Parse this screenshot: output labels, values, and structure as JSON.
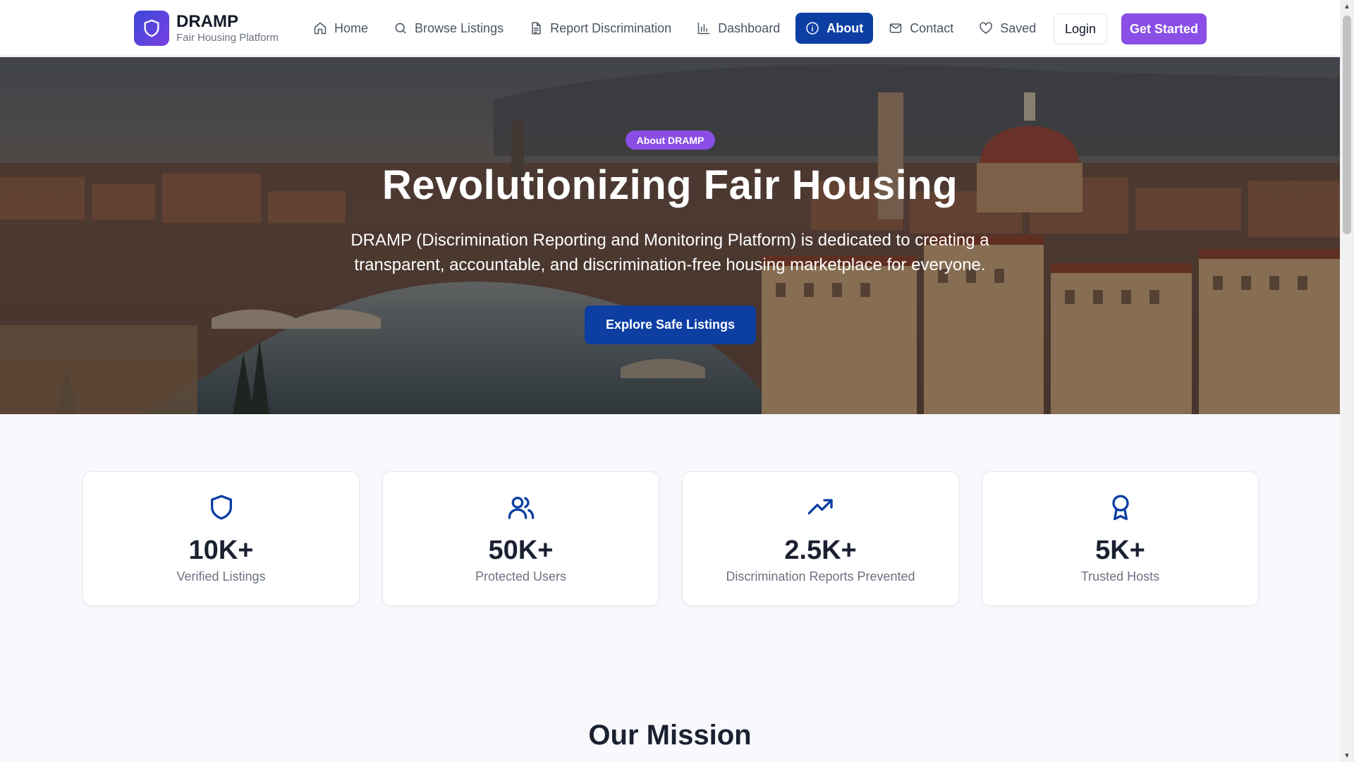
{
  "brand": {
    "name": "DRAMP",
    "tagline": "Fair Housing Platform",
    "logo_icon": "shield-icon"
  },
  "nav": {
    "items": [
      {
        "label": "Home",
        "icon": "home-icon",
        "active": false
      },
      {
        "label": "Browse Listings",
        "icon": "search-icon",
        "active": false
      },
      {
        "label": "Report Discrimination",
        "icon": "document-icon",
        "active": false
      },
      {
        "label": "Dashboard",
        "icon": "bar-chart-icon",
        "active": false
      },
      {
        "label": "About",
        "icon": "info-icon",
        "active": true
      },
      {
        "label": "Contact",
        "icon": "mail-icon",
        "active": false
      },
      {
        "label": "Saved",
        "icon": "heart-icon",
        "active": false
      }
    ],
    "login_label": "Login",
    "get_started_label": "Get Started"
  },
  "hero": {
    "badge": "About DRAMP",
    "title": "Revolutionizing Fair Housing",
    "description": "DRAMP (Discrimination Reporting and Monitoring Platform) is dedicated to creating a transparent, accountable, and discrimination-free housing marketplace for everyone.",
    "cta_label": "Explore Safe Listings"
  },
  "stats": [
    {
      "value": "10K+",
      "label": "Verified Listings",
      "icon": "shield-icon"
    },
    {
      "value": "50K+",
      "label": "Protected Users",
      "icon": "users-icon"
    },
    {
      "value": "2.5K+",
      "label": "Discrimination Reports Prevented",
      "icon": "trending-up-icon"
    },
    {
      "value": "5K+",
      "label": "Trusted Hosts",
      "icon": "award-icon"
    }
  ],
  "mission": {
    "title": "Our Mission"
  },
  "colors": {
    "primary": "#0d3fa3",
    "accent": "#8a4ee6",
    "background": "#f8f8fd"
  }
}
